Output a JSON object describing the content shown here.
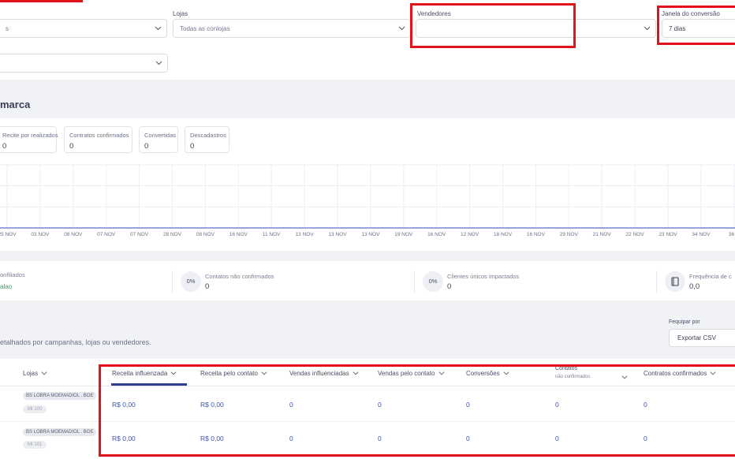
{
  "filters": {
    "lojas_label": "Lojas",
    "lojas_value": "Todas as conlojas",
    "first_value": "s",
    "vendedores_label": "Vendedores",
    "vendedores_value": "",
    "janela_label": "Janela do conversão",
    "janela_value": "7 dias",
    "second_row_value": ""
  },
  "section": {
    "title": "marca"
  },
  "stats": [
    {
      "label": "Recite por realizados",
      "value": "0"
    },
    {
      "label": "Contratos confirmados",
      "value": "0"
    },
    {
      "label": "Convertidas",
      "value": "0"
    },
    {
      "label": "Descadastros",
      "value": "0"
    }
  ],
  "chart_data": {
    "type": "line",
    "categories": [
      "25 NOV",
      "03 NOV",
      "08 NOV",
      "07 NOV",
      "07 NOV",
      "28 NOV",
      "08 NOV",
      "16 NOV",
      "11 NOV",
      "13 NOV",
      "13 NOV",
      "13 NOV",
      "19 NOV",
      "16 NOV",
      "12 NOV",
      "18 NOV",
      "16 NOV",
      "29 NOV",
      "21 NOV",
      "22 NOV",
      "23 NOV",
      "34 NOV",
      "36 N"
    ],
    "series": [
      {
        "values": [
          0,
          0,
          0,
          0,
          0,
          0,
          0,
          0,
          0,
          0,
          0,
          0,
          0,
          0,
          0,
          0,
          0,
          0,
          0,
          0,
          0,
          0,
          0
        ]
      }
    ],
    "line_color": "#5a6fc8",
    "grid": true
  },
  "kpis": [
    {
      "label": "onfiliados",
      "value": "",
      "link": "alao"
    },
    {
      "badge": "0%",
      "label": "Contatos não confirmados",
      "value": "0"
    },
    {
      "badge": "0%",
      "label": "Clientes únicos impactados",
      "value": "0"
    },
    {
      "label": "Frequência de c",
      "value": "0,0",
      "icon": "book-icon"
    }
  ],
  "details": {
    "description": "etalhados por campanhas, lojas ou vendedores.",
    "group_label": "Fequipar por",
    "export_label": "Exportar CSV"
  },
  "table": {
    "columns": [
      "Lojas",
      "Receita influenzada",
      "Receita pelo contato",
      "Vendas influenciadas",
      "Vendas pelo contato",
      "Conversões",
      "Contatos",
      "Contratos confirmados"
    ],
    "column_sub": "não confirmados",
    "rows": [
      {
        "store": "BS LOBRA MOEMADIOL . BOE",
        "tag": "Mt 100",
        "receita_influenciada": "R$ 0,00",
        "receita_contato": "R$ 0,00",
        "vendas_influenciadas": "0",
        "vendas_contato": "0",
        "conversoes": "0",
        "contatos": "0",
        "contratos": "0"
      },
      {
        "store": "BS LOBRA MOEMADIOL . BOE",
        "tag": "Mt 101",
        "receita_influenciada": "R$ 0,00",
        "receita_contato": "R$ 0,00",
        "vendas_influenciadas": "0",
        "vendas_contato": "0",
        "conversoes": "0",
        "contatos": "0",
        "contratos": "0"
      }
    ]
  },
  "colors": {
    "highlight": "#e0121a",
    "link": "#3f56a8",
    "accent": "#2c3e8f",
    "green": "#2aa36b"
  }
}
